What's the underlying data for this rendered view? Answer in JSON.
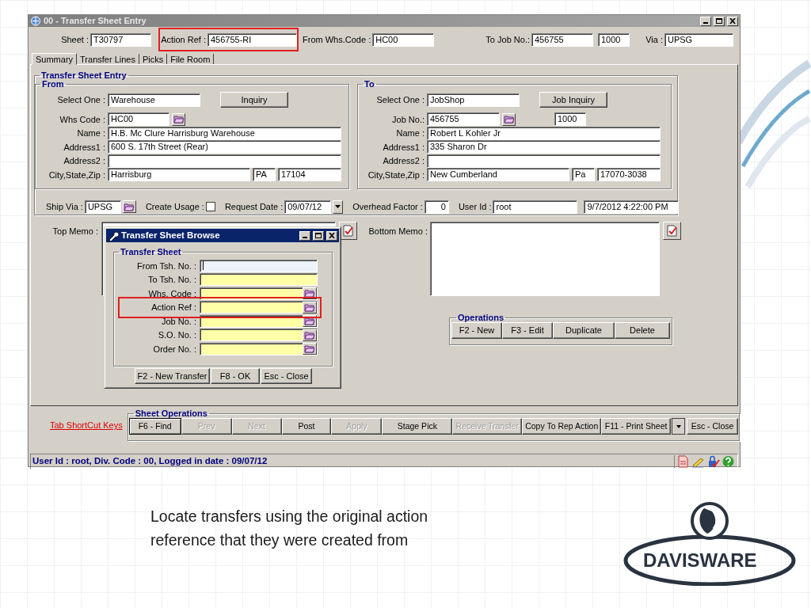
{
  "window": {
    "title": "00 - Transfer Sheet Entry"
  },
  "header_fields": [
    {
      "label": "Sheet :",
      "value": "T30797",
      "highlighted": false
    },
    {
      "label": "Action Ref :",
      "value": "456755-RI",
      "highlighted": true
    },
    {
      "label": "From Whs.Code :",
      "value": "HC00",
      "highlighted": false
    },
    {
      "label": "To Job No.:",
      "value": "456755",
      "highlighted": false
    },
    {
      "value": "1000",
      "highlighted": false
    },
    {
      "label": "Via :",
      "value": "UPSG",
      "highlighted": false
    }
  ],
  "tabs": [
    {
      "label": "Summary",
      "selected": true
    },
    {
      "label": "Transfer Lines",
      "selected": false
    },
    {
      "label": "Picks",
      "selected": false
    },
    {
      "label": "File Room",
      "selected": false
    }
  ],
  "entry_group": {
    "title": "Transfer Sheet Entry"
  },
  "panels": [
    {
      "title": "From",
      "select": {
        "label": "Select One :",
        "value": "Warehouse"
      },
      "button": "Inquiry",
      "rows": [
        {
          "kind": "code",
          "label": "Whs Code :",
          "value": "HC00"
        },
        {
          "kind": "full",
          "label": "Name :",
          "value": "H.B. Mc Clure Harrisburg Warehouse"
        },
        {
          "kind": "full",
          "label": "Address1 :",
          "value": "600 S. 17th Street (Rear)"
        },
        {
          "kind": "full",
          "label": "Address2 :"
        },
        {
          "kind": "city",
          "label": "City,State,Zip :",
          "city": "Harrisburg",
          "state": "PA",
          "zip": "17104"
        }
      ]
    },
    {
      "title": "To",
      "select": {
        "label": "Select One :",
        "value": "JobShop"
      },
      "button": "Job Inquiry",
      "rows": [
        {
          "kind": "code",
          "label": "Job No.:",
          "value": "456755",
          "extra": "1000"
        },
        {
          "kind": "full",
          "label": "Name :",
          "value": "Robert L Kohler Jr"
        },
        {
          "kind": "full",
          "label": "Address1 :",
          "value": " 335 Sharon Dr"
        },
        {
          "kind": "full",
          "label": "Address2 :"
        },
        {
          "kind": "city",
          "label": "City,State,Zip :",
          "city": "New Cumberland",
          "state": "Pa",
          "zip": "17070-3038"
        }
      ]
    }
  ],
  "details": [
    {
      "kind": "lookup",
      "label": "Ship Via :",
      "value": "UPSG"
    },
    {
      "kind": "checkbox",
      "label": "Create Usage :",
      "checked": false
    },
    {
      "kind": "date",
      "label": "Request Date :",
      "value": "09/07/12"
    },
    {
      "kind": "number",
      "label": "Overhead Factor :",
      "value": "0"
    },
    {
      "kind": "text",
      "label": "User Id :",
      "value": "root"
    },
    {
      "kind": "stamp",
      "value": "9/7/2012 4:22:00 PM"
    }
  ],
  "memos": [
    {
      "label": "Top Memo :"
    },
    {
      "label": "Bottom Memo :"
    }
  ],
  "operations": {
    "title": "Operations",
    "buttons": [
      "F2 - New",
      "F3 - Edit",
      "Duplicate",
      "Delete"
    ]
  },
  "shortcut_link": "Tab ShortCut Keys",
  "sheet_operations": {
    "title": "Sheet Operations",
    "buttons": [
      {
        "kind": "button",
        "label": "F6 - Find",
        "disabled": false,
        "default": true
      },
      {
        "kind": "button",
        "label": "Prev",
        "disabled": true,
        "default": false
      },
      {
        "kind": "button",
        "label": "Next",
        "disabled": true,
        "default": false
      },
      {
        "kind": "button",
        "label": "Post",
        "disabled": false,
        "default": false
      },
      {
        "kind": "button",
        "label": "Apply",
        "disabled": true,
        "default": false
      },
      {
        "kind": "button",
        "label": "Stage Pick",
        "disabled": false,
        "default": false
      },
      {
        "kind": "button",
        "label": "Receive Transfer",
        "disabled": true,
        "default": false
      },
      {
        "kind": "button",
        "label": "Copy To Rep Action",
        "disabled": false,
        "default": false
      },
      {
        "kind": "split",
        "label": "F11 - Print Sheet",
        "disabled": false,
        "default": false
      },
      {
        "kind": "button",
        "label": "Esc - Close",
        "disabled": false,
        "default": false
      }
    ]
  },
  "status_bar": {
    "text": "User Id : root, Div. Code : 00, Logged in date : 09/07/12"
  },
  "dialog": {
    "title": "Transfer Sheet Browse",
    "group_title": "Transfer Sheet",
    "fields": [
      {
        "label": "From Tsh. No. :",
        "lookup": false,
        "focused": true,
        "highlighted": false
      },
      {
        "label": "To Tsh. No. :",
        "lookup": false,
        "focused": false,
        "highlighted": false
      },
      {
        "label": "Whs. Code :",
        "lookup": true,
        "focused": false,
        "highlighted": false
      },
      {
        "label": "Action Ref :",
        "lookup": true,
        "focused": false,
        "highlighted": true
      },
      {
        "label": "Job No. :",
        "lookup": true,
        "focused": false,
        "highlighted": false
      },
      {
        "label": "S.O. No. :",
        "lookup": true,
        "focused": false,
        "highlighted": false
      },
      {
        "label": "Order No. :",
        "lookup": true,
        "focused": false,
        "highlighted": false
      }
    ],
    "buttons": [
      "F2 - New Transfer",
      "F8 - OK",
      "Esc - Close"
    ]
  },
  "caption": {
    "lines": [
      "Locate transfers using the original action",
      "reference that they were created from"
    ]
  },
  "logo": {
    "text": "DAVISWARE"
  }
}
